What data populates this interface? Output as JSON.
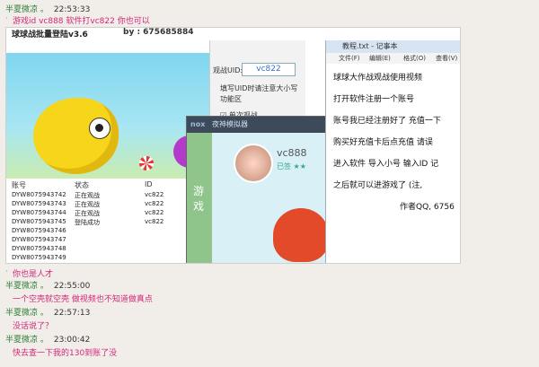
{
  "messages": [
    {
      "sender": "半夏微凉 。",
      "time": "22:53:33",
      "text": "游戏id vc888 软件打vc822 你也可以"
    },
    {
      "sender": "",
      "time": "",
      "text": "你也是人才"
    },
    {
      "sender": "半夏微凉 。",
      "time": "22:55:00",
      "text": "一个空壳就空壳  做视频也不知道做真点"
    },
    {
      "sender": "半夏微凉 。",
      "time": "22:57:13",
      "text": "没话说了？"
    },
    {
      "sender": "半夏微凉 。",
      "time": "23:00:42",
      "text": "快去查一下我的130到账了没"
    }
  ],
  "screenshot": {
    "app_title": "球球战批量登陆v3.6",
    "qq_label": "by : 675685884",
    "vid_label": "观战UID:",
    "vid_value": "vc822",
    "hint": "填写UID时请注意大小写功能区",
    "checkbox": "☑ 单次观战",
    "table": {
      "headers": [
        "账号",
        "状态",
        "ID"
      ],
      "rows": [
        [
          "DYW8075943742",
          "正在观战",
          "vc822"
        ],
        [
          "DYW8075943743",
          "正在观战",
          "vc822"
        ],
        [
          "DYW8075943744",
          "正在观战",
          "vc822"
        ],
        [
          "DYW8075943745",
          "登陆成功",
          "vc822"
        ],
        [
          "DYW8075943746",
          "",
          ""
        ],
        [
          "DYW8075943747",
          "",
          ""
        ],
        [
          "DYW8075943748",
          "",
          ""
        ],
        [
          "DYW8075943749",
          "",
          ""
        ]
      ]
    },
    "nox": {
      "logo": "nox",
      "title": "夜神模拟器",
      "side_text": "游戏",
      "username": "vc888",
      "status": "已签 ★★"
    },
    "notepad": {
      "title": "教程.txt - 记事本",
      "menu": [
        "文件(F)",
        "编辑(E)",
        "格式(O)",
        "查看(V)"
      ],
      "lines": [
        "球球大作战观战使用视频",
        "打开软件注册一个账号",
        "账号我已经注册好了 充值一下",
        "购买好充值卡后点充值  请误",
        "进入软件 导入小号 输入ID 记",
        "之后就可以进游戏了  (注, ",
        "作者QQ, 6756"
      ]
    }
  }
}
